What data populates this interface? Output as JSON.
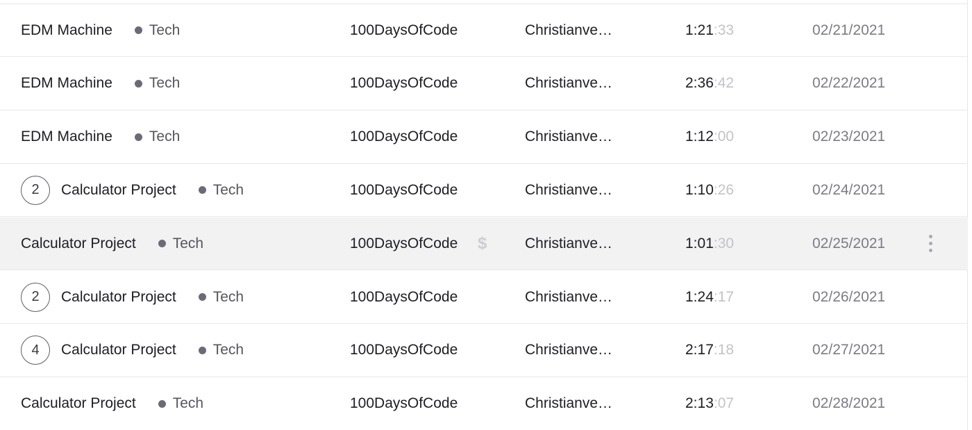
{
  "colors": {
    "project_dot": "#6b6b78",
    "row_selected_bg": "#f2f2f2",
    "seconds_text": "#c3c3c8",
    "date_text": "#7b7b85"
  },
  "icons": {
    "billable": "dollar-icon",
    "more": "more-vertical-icon"
  },
  "entries": [
    {
      "description": "EDM Machine",
      "group_count": "",
      "project": "Tech",
      "tag": "100DaysOfCode",
      "user": "Christianveg…",
      "duration_main": "1:21",
      "duration_seconds": ":33",
      "date": "02/21/2021",
      "selected": false
    },
    {
      "description": "EDM Machine",
      "group_count": "",
      "project": "Tech",
      "tag": "100DaysOfCode",
      "user": "Christianveg…",
      "duration_main": "2:36",
      "duration_seconds": ":42",
      "date": "02/22/2021",
      "selected": false
    },
    {
      "description": "EDM Machine",
      "group_count": "",
      "project": "Tech",
      "tag": "100DaysOfCode",
      "user": "Christianveg…",
      "duration_main": "1:12",
      "duration_seconds": ":00",
      "date": "02/23/2021",
      "selected": false
    },
    {
      "description": "Calculator Project",
      "group_count": "2",
      "project": "Tech",
      "tag": "100DaysOfCode",
      "user": "Christianveg…",
      "duration_main": "1:10",
      "duration_seconds": ":26",
      "date": "02/24/2021",
      "selected": false
    },
    {
      "description": "Calculator Project",
      "group_count": "",
      "project": "Tech",
      "tag": "100DaysOfCode",
      "user": "Christianveg…",
      "duration_main": "1:01",
      "duration_seconds": ":30",
      "date": "02/25/2021",
      "selected": true,
      "billable_symbol": "$"
    },
    {
      "description": "Calculator Project",
      "group_count": "2",
      "project": "Tech",
      "tag": "100DaysOfCode",
      "user": "Christianveg…",
      "duration_main": "1:24",
      "duration_seconds": ":17",
      "date": "02/26/2021",
      "selected": false
    },
    {
      "description": "Calculator Project",
      "group_count": "4",
      "project": "Tech",
      "tag": "100DaysOfCode",
      "user": "Christianveg…",
      "duration_main": "2:17",
      "duration_seconds": ":18",
      "date": "02/27/2021",
      "selected": false
    },
    {
      "description": "Calculator Project",
      "group_count": "",
      "project": "Tech",
      "tag": "100DaysOfCode",
      "user": "Christianveg…",
      "duration_main": "2:13",
      "duration_seconds": ":07",
      "date": "02/28/2021",
      "selected": false
    }
  ]
}
